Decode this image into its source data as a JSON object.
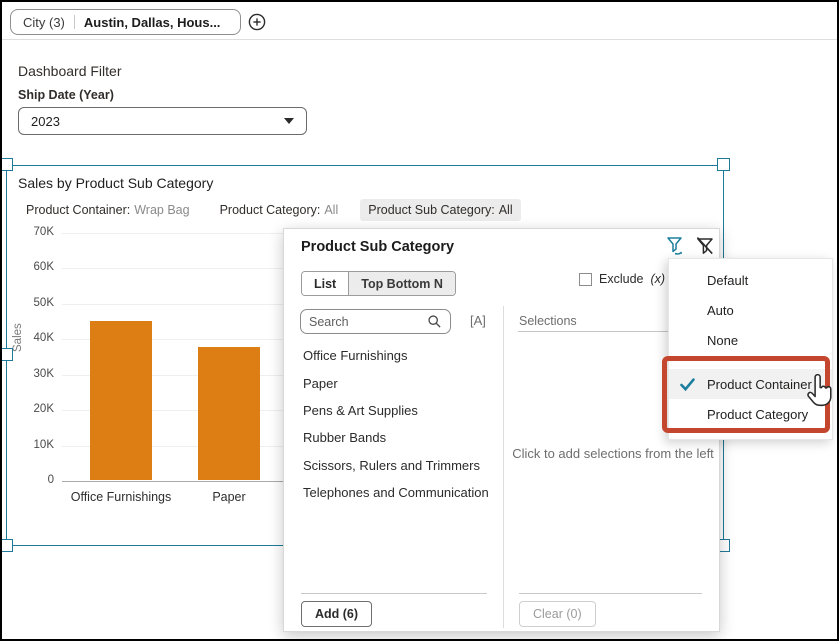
{
  "topbar": {
    "chip_label": "City (3)",
    "chip_values": "Austin, Dallas, Hous...",
    "add_icon": "plus-circle-icon"
  },
  "dashboard_filter": {
    "title": "Dashboard Filter",
    "field_label": "Ship Date (Year)",
    "value": "2023"
  },
  "chart_panel": {
    "title": "Sales by Product Sub Category",
    "filters": [
      {
        "label": "Product Container:",
        "value": "Wrap Bag",
        "highlighted": false,
        "value_muted": true
      },
      {
        "label": "Product Category:",
        "value": "All",
        "highlighted": false,
        "value_muted": true
      },
      {
        "label": "Product Sub Category:",
        "value": "All",
        "highlighted": true,
        "value_muted": false
      }
    ]
  },
  "chart_data": {
    "type": "bar",
    "title": "Sales by Product Sub Category",
    "categories": [
      "Office Furnishings",
      "Paper"
    ],
    "values": [
      45000,
      37500
    ],
    "xlabel": "",
    "ylabel": "Sales",
    "ylim": [
      0,
      70000
    ],
    "ytick_values": [
      0,
      10000,
      20000,
      30000,
      40000,
      50000,
      60000,
      70000
    ],
    "ytick_labels": [
      "0",
      "10K",
      "20K",
      "30K",
      "40K",
      "50K",
      "60K",
      "70K"
    ],
    "grid": true,
    "legend": "none",
    "bar_color": "#DD7E15"
  },
  "filter_popup": {
    "title": "Product Sub Category",
    "icons": [
      "limit-values-funnel-icon",
      "clear-filter-funnel-icon"
    ],
    "tabs": [
      {
        "label": "List",
        "active": true
      },
      {
        "label": "Top Bottom N",
        "active": false
      }
    ],
    "exclude_label": "Exclude",
    "exclude_suffix": "(x)",
    "search_placeholder": "Search",
    "match_case_label": "[A]",
    "items": [
      "Office Furnishings",
      "Paper",
      "Pens & Art Supplies",
      "Rubber Bands",
      "Scissors, Rulers and Trimmers",
      "Telephones and Communication"
    ],
    "selections_label": "Selections",
    "empty_text": "Click to add selections from the left",
    "add_button": "Add (6)",
    "clear_button": "Clear (0)"
  },
  "menu": {
    "items": [
      {
        "label": "Default",
        "checked": false,
        "highlighted": false,
        "group_start": false
      },
      {
        "label": "Auto",
        "checked": false,
        "highlighted": false,
        "group_start": false
      },
      {
        "label": "None",
        "checked": false,
        "highlighted": false,
        "group_start": false
      },
      {
        "label": "Product Container",
        "checked": true,
        "highlighted": true,
        "group_start": true
      },
      {
        "label": "Product Category",
        "checked": false,
        "highlighted": false,
        "group_start": false
      }
    ]
  },
  "colors": {
    "selection_teal": "#1F7A99",
    "check_teal": "#1B7F9E",
    "bar_orange": "#DD7E15",
    "annotation_red": "#C5462E"
  }
}
